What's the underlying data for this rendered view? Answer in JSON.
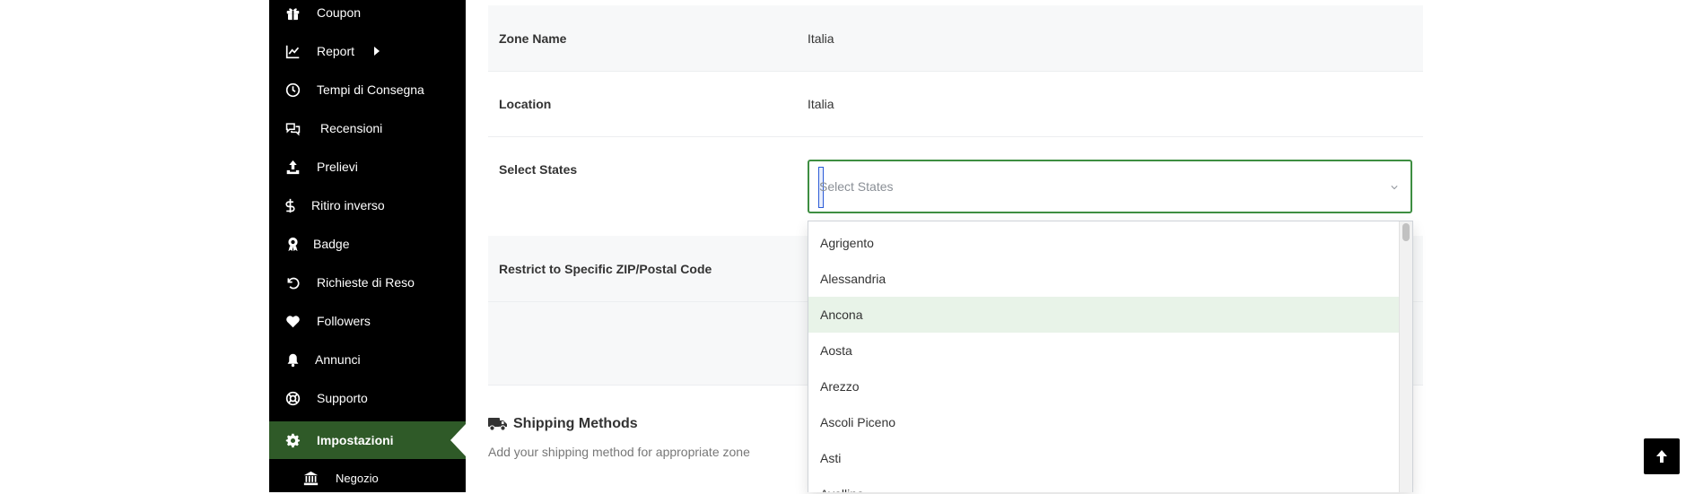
{
  "sidebar": {
    "items": [
      {
        "label": "Coupon",
        "icon": "gift-icon"
      },
      {
        "label": "Report",
        "icon": "line-chart-icon"
      },
      {
        "label": "Tempi di Consegna",
        "icon": "clock-icon"
      },
      {
        "label": "Recensioni",
        "icon": "comments-icon"
      },
      {
        "label": "Prelievi",
        "icon": "upload-icon"
      },
      {
        "label": "Ritiro inverso",
        "icon": "dollar-icon"
      },
      {
        "label": "Badge",
        "icon": "award-icon"
      },
      {
        "label": "Richieste di Reso",
        "icon": "undo-icon"
      },
      {
        "label": "Followers",
        "icon": "heart-icon"
      },
      {
        "label": "Annunci",
        "icon": "bell-icon"
      },
      {
        "label": "Supporto",
        "icon": "lifebuoy-icon"
      },
      {
        "label": "Impostazioni",
        "icon": "gear-icon",
        "active": true
      },
      {
        "label": "Negozio",
        "icon": "bank-icon"
      }
    ]
  },
  "form": {
    "zone_name_label": "Zone Name",
    "zone_name_value": "Italia",
    "location_label": "Location",
    "location_value": "Italia",
    "select_states_label": "Select States",
    "select_states_placeholder": "Select States",
    "restrict_zip_label": "Restrict to Specific ZIP/Postal Code"
  },
  "dropdown": {
    "options": [
      "Agrigento",
      "Alessandria",
      "Ancona",
      "Aosta",
      "Arezzo",
      "Ascoli Piceno",
      "Asti",
      "Avellino"
    ],
    "highlighted": "Ancona"
  },
  "shipping": {
    "title": "Shipping Methods",
    "subtitle": "Add your shipping method for appropriate zone"
  },
  "colors": {
    "sidebar_bg": "#000000",
    "active_bg": "#2f5a28",
    "focus_border": "#3e8e41",
    "highlight_bg": "#e8f3e8"
  }
}
